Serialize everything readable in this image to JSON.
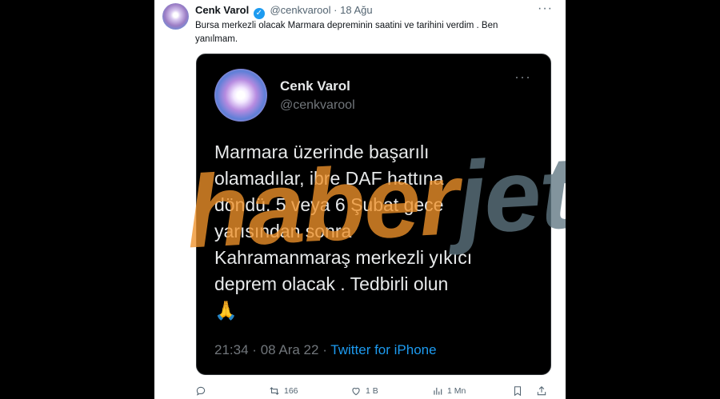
{
  "tweet": {
    "author_name": "Cenk Varol",
    "handle": "@cenkvarool",
    "separator": "·",
    "date": "18 Ağu",
    "text": "Bursa merkezli olacak Marmara depreminin saatini ve tarihini verdim . Ben yanılmam.",
    "more": "···"
  },
  "quoted_tweet": {
    "author_name": "Cenk Varol",
    "handle": "@cenkvarool",
    "more": "···",
    "text": "Marmara üzerinde başarılı\nolamadılar, ibre DAF hattına\ndöndü. 5 veya 6 Şubat gece\nyarısından sonra\nKahramanmaraş merkezli yıkıcı\ndeprem olacak . Tedbirli olun\n🙏",
    "time": "21:34",
    "date_sep": "·",
    "date": "08 Ara 22",
    "source_sep": "·",
    "source": "Twitter for iPhone"
  },
  "watermark": {
    "part1": "haber",
    "part2": "jet"
  },
  "actions": {
    "reply": "",
    "retweet": "166",
    "like": "1 B",
    "views": "1 Mn"
  },
  "colors": {
    "verified": "#1d9bf0",
    "watermark_orange": "#f0932b",
    "watermark_gray": "#5f7782"
  }
}
